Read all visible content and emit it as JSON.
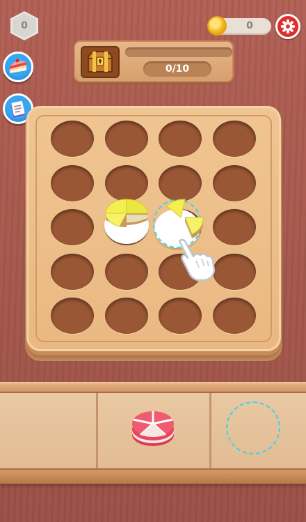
{
  "hud": {
    "level_count": "0",
    "coin_count": "0",
    "settings_icon": "gear-icon",
    "colors": {
      "settings_red": "#e22d2d",
      "side_button_blue": "#2b8ee0",
      "coin_gold": "#f5b818"
    }
  },
  "side_buttons": [
    {
      "name": "cake-collection-button",
      "icon": "cake-slice-icon"
    },
    {
      "name": "recipe-book-button",
      "icon": "recipe-book-icon"
    }
  ],
  "progress": {
    "icon": "treasure-chest-icon",
    "count_label": "0/10",
    "fraction": 0.0
  },
  "board": {
    "rows": 5,
    "cols": 4,
    "pieces": [
      {
        "row": 2,
        "col": 1,
        "flavor": "lemon",
        "slices": 4,
        "color": "#f3ef4e"
      },
      {
        "row": 2,
        "col": 2,
        "flavor": "lemon",
        "slices": 2,
        "color": "#f3ef4e",
        "held": true
      }
    ]
  },
  "tray": {
    "slots": [
      {
        "content": "empty"
      },
      {
        "content": "strawberry-cake",
        "slices": 5,
        "color": "#f0546a"
      },
      {
        "content": "drop-target"
      }
    ]
  },
  "tutorial_hand": "pointing-glove-icon"
}
